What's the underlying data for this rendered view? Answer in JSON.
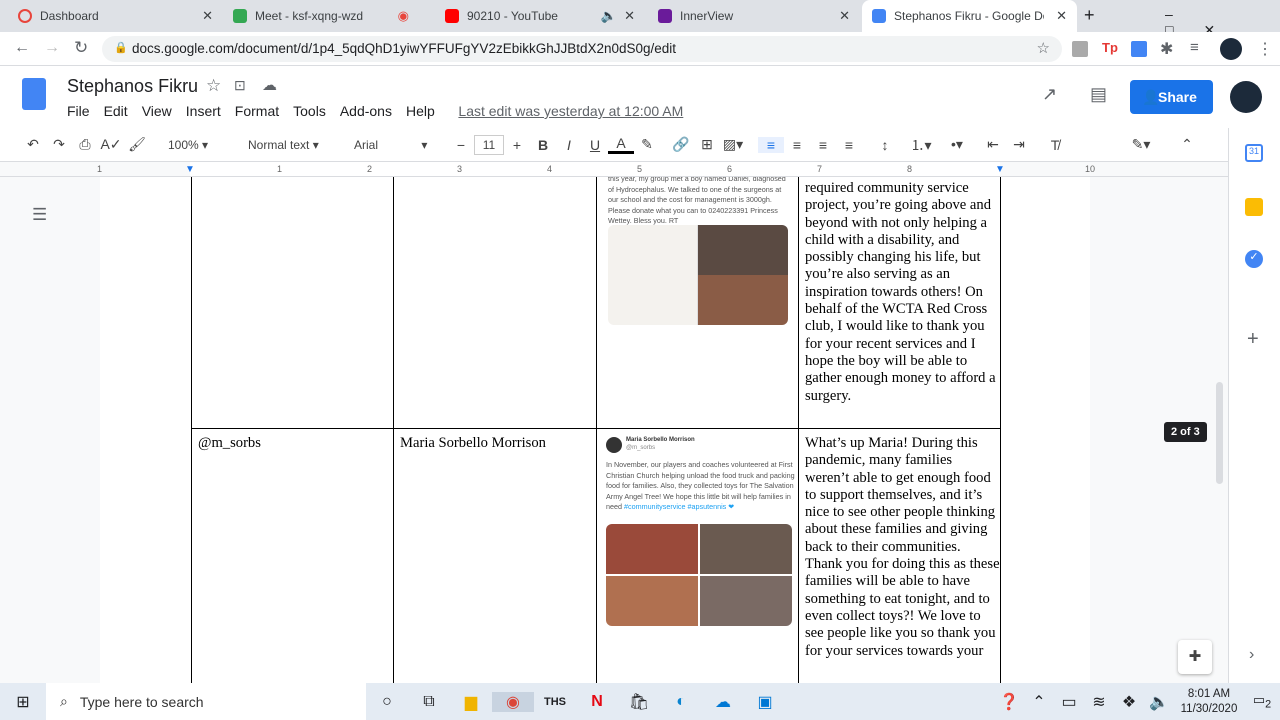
{
  "tabs": [
    {
      "label": "Dashboard",
      "color": "#e8453c"
    },
    {
      "label": "Meet - ksf-xqng-wzd",
      "color": "#34a853"
    },
    {
      "label": "90210 - YouTube",
      "color": "#ff0000"
    },
    {
      "label": "InnerView",
      "color": "#6a1b9a"
    },
    {
      "label": "Stephanos Fikru - Google Docs",
      "color": "#4285f4"
    }
  ],
  "url": "docs.google.com/document/d/1p4_5qdQhD1yiwYFFUFgYV2zEbikkGhJJBtdX2n0dS0g/edit",
  "doc": {
    "title": "Stephanos Fikru",
    "menu": [
      "File",
      "Edit",
      "View",
      "Insert",
      "Format",
      "Tools",
      "Add-ons",
      "Help"
    ],
    "last_edit": "Last edit was yesterday at 12:00 AM",
    "share": "Share"
  },
  "toolbar": {
    "zoom": "100%",
    "style": "Normal text",
    "font": "Arial",
    "size": "11"
  },
  "ruler": [
    "1",
    "1",
    "2",
    "3",
    "4",
    "5",
    "6",
    "7",
    "8",
    "9",
    "10"
  ],
  "rows": [
    {
      "handle": "",
      "name": "",
      "tweet": "this year, my group met a boy named Daniel, diagnosed of Hydrocephalus. We talked to one of the surgeons at our school and the cost for management is 3000gh. Please donate what you can to 0240223391 Princess Wettey. Bless you. RT",
      "reply": "required community service project, you’re going above and beyond with not only helping a child with a disability, and possibly changing his life, but you’re also serving as an inspiration towards others! On behalf of the WCTA Red Cross club, I would like to thank you for your recent services and I hope the boy will be able to gather enough money to afford a surgery."
    },
    {
      "handle": "@m_sorbs",
      "name": "Maria Sorbello Morrison",
      "tweet_author": "Maria Sorbello Morrison",
      "tweet_handle": "@m_sorbs",
      "tweet": "In November, our players and coaches volunteered at First Christian Church helping unload the food truck and packing food for families. Also, they collected toys for The Salvation Army Angel Tree! We hope this little bit will help families in need",
      "tweet_tags": "#communityservice #apsutennis ❤",
      "reply": "What’s up Maria! During this pandemic, many families weren’t able to get enough food to support themselves, and it’s nice to see other people thinking about these families and giving back to their communities. Thank you for doing this as these families will be able to have something to eat tonight, and to even collect toys?! We love to see people like you so thank you for your services towards your"
    }
  ],
  "page_indicator": "2 of 3",
  "taskbar": {
    "search": "Type here to search",
    "time": "8:01 AM",
    "date": "11/30/2020",
    "notif": "2"
  }
}
